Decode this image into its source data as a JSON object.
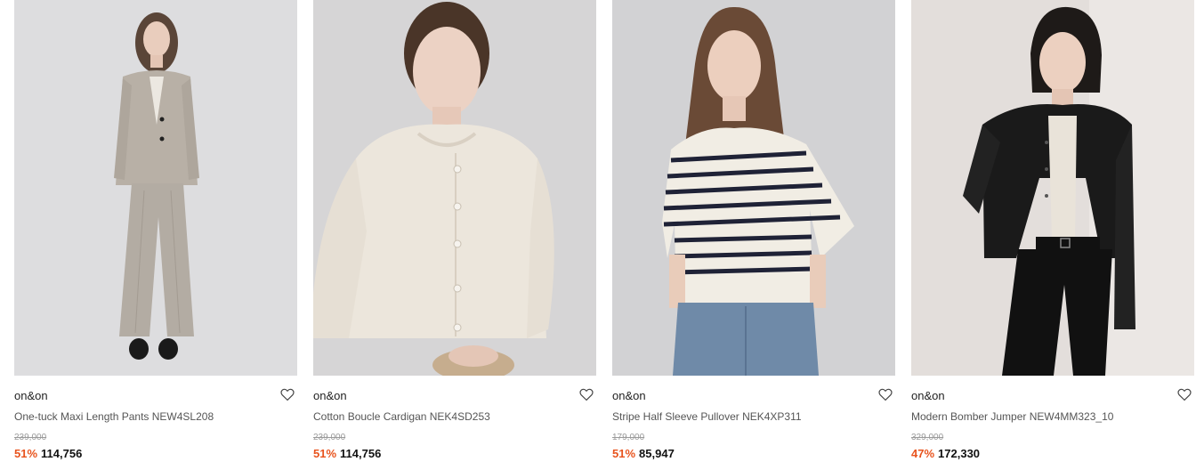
{
  "products": [
    {
      "brand": "on&on",
      "name": "One-tuck Maxi Length Pants NEW4SL208",
      "original_price": "239,000",
      "discount": "51%",
      "price": "114,756",
      "photo_bg": "#dddddf",
      "garment_color": "#b5aca2"
    },
    {
      "brand": "on&on",
      "name": "Cotton Boucle Cardigan NEK4SD253",
      "original_price": "239,000",
      "discount": "51%",
      "price": "114,756",
      "photo_bg": "#d6d5d6",
      "garment_color": "#ece6dc"
    },
    {
      "brand": "on&on",
      "name": "Stripe Half Sleeve Pullover NEK4XP311",
      "original_price": "179,000",
      "discount": "51%",
      "price": "85,947",
      "photo_bg": "#d2d2d4",
      "garment_color": "#f1ede4"
    },
    {
      "brand": "on&on",
      "name": "Modern Bomber Jumper NEW4MM323_10",
      "original_price": "329,000",
      "discount": "47%",
      "price": "172,330",
      "photo_bg": "#e3dedb",
      "garment_color": "#1a1a1a"
    }
  ],
  "colors": {
    "discount": "#e8541e",
    "original_price": "#9a9a9a",
    "heart_icon": "#444444"
  }
}
